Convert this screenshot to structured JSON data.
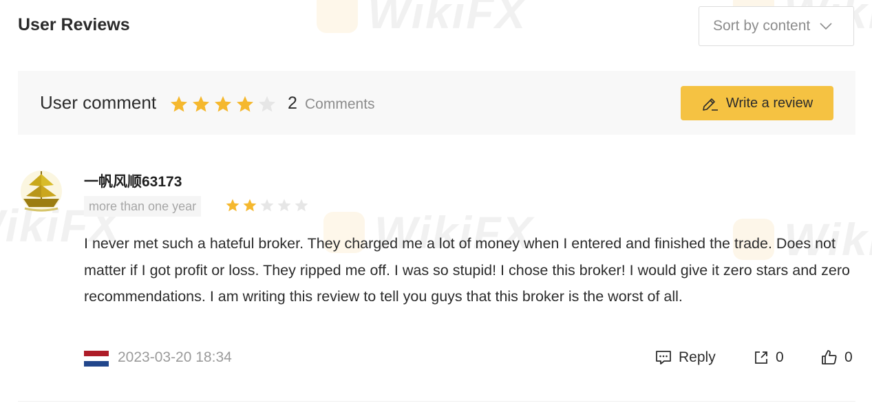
{
  "header": {
    "title": "User Reviews"
  },
  "sort": {
    "label": "Sort by content"
  },
  "summary": {
    "label": "User comment",
    "rating": 4,
    "max_rating": 5,
    "comment_count": "2",
    "comment_text": "Comments",
    "write_label": "Write a review"
  },
  "review": {
    "username": "一帆风顺63173",
    "time_tag": "more than one year",
    "rating": 2,
    "max_rating": 5,
    "text": "I never met such a hateful broker. They charged me a lot of money when I entered and finished the trade. Does not matter if I got profit or loss. They ripped me off. I was so stupid! I chose this broker! I would give it zero stars and zero recommendations. I am writing this review to tell you guys that this broker is the worst of all.",
    "date": "2023-03-20 18:34",
    "reply_label": "Reply",
    "share_count": "0",
    "like_count": "0",
    "flag_country": "Netherlands"
  },
  "watermark": {
    "text": "WikiFX"
  },
  "colors": {
    "star_filled": "#f5b82e",
    "star_empty": "#e6e6e6",
    "accent": "#f5c242",
    "flag_red": "#ae1c28",
    "flag_blue": "#21468b"
  },
  "icons": {
    "sort": "chevron-down-icon",
    "write": "pen-icon",
    "reply": "comment-icon",
    "share": "share-icon",
    "like": "thumbs-up-icon"
  }
}
